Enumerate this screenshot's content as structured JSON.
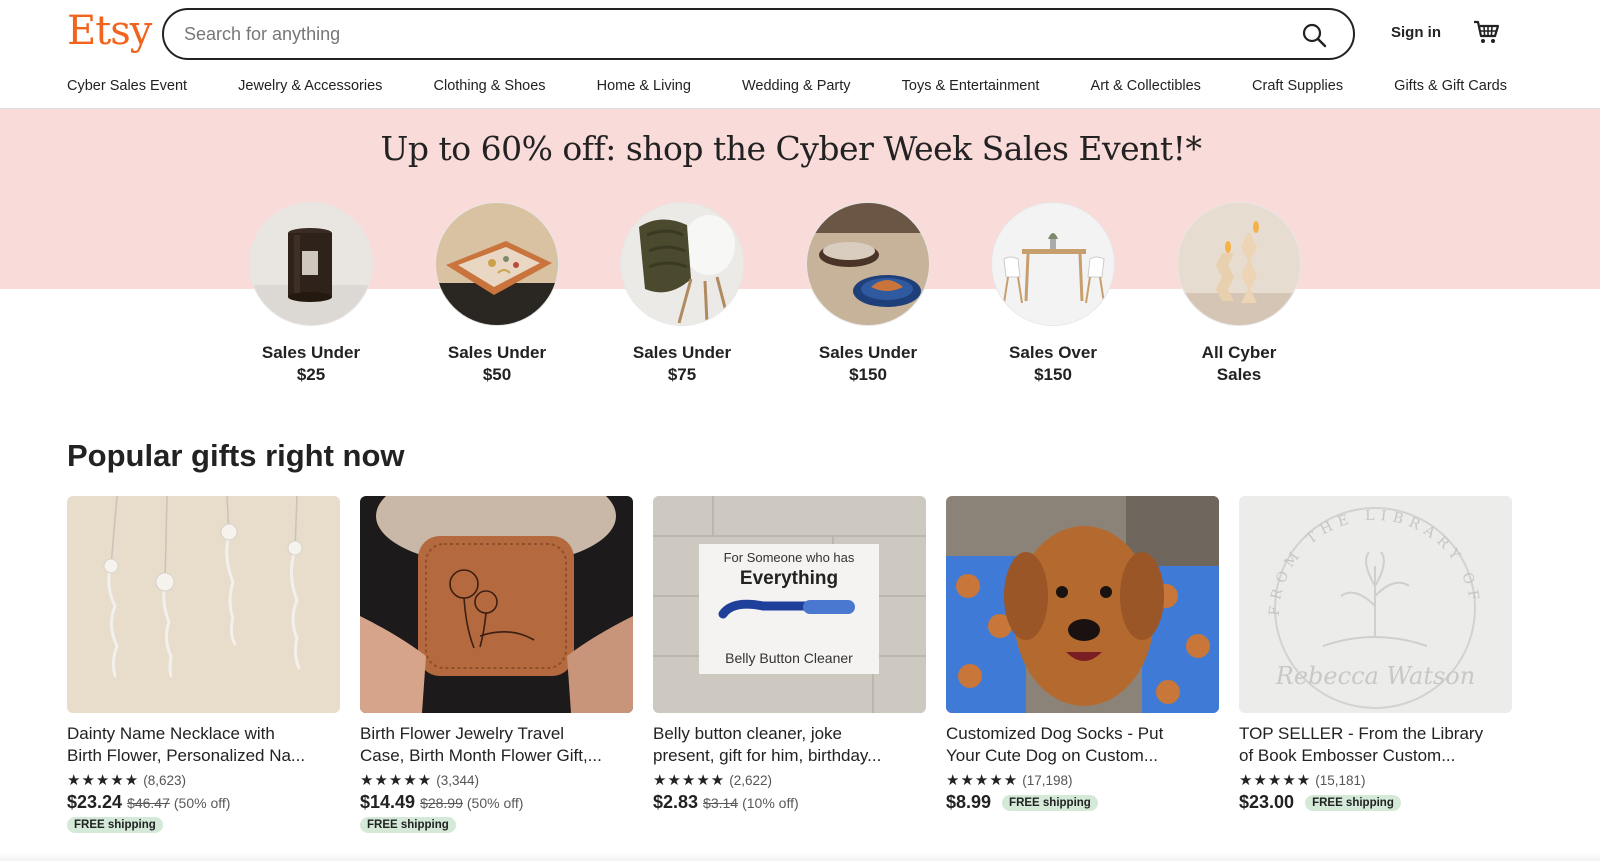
{
  "header": {
    "logo": "Etsy",
    "search_placeholder": "Search for anything",
    "sign_in": "Sign in"
  },
  "nav": [
    "Cyber Sales Event",
    "Jewelry & Accessories",
    "Clothing & Shoes",
    "Home & Living",
    "Wedding & Party",
    "Toys & Entertainment",
    "Art & Collectibles",
    "Craft Supplies",
    "Gifts & Gift Cards"
  ],
  "banner": {
    "title": "Up to 60% off: shop the Cyber Week Sales Event!*",
    "categories": [
      {
        "line1": "Sales Under",
        "line2": "$25"
      },
      {
        "line1": "Sales Under",
        "line2": "$50"
      },
      {
        "line1": "Sales Under",
        "line2": "$75"
      },
      {
        "line1": "Sales Under",
        "line2": "$150"
      },
      {
        "line1": "Sales Over",
        "line2": "$150"
      },
      {
        "line1": "All Cyber",
        "line2": "Sales"
      }
    ]
  },
  "popular": {
    "title": "Popular gifts right now",
    "items": [
      {
        "title1": "Dainty Name Necklace with",
        "title2": "Birth Flower, Personalized Na...",
        "stars": "★★★★★",
        "reviews": "(8,623)",
        "price": "$23.24",
        "original": "$46.47",
        "discount": "(50% off)",
        "shipping": "FREE shipping"
      },
      {
        "title1": "Birth Flower Jewelry Travel",
        "title2": "Case, Birth Month Flower Gift,...",
        "stars": "★★★★★",
        "reviews": "(3,344)",
        "price": "$14.49",
        "original": "$28.99",
        "discount": "(50% off)",
        "shipping": "FREE shipping"
      },
      {
        "title1": "Belly button cleaner, joke",
        "title2": "present, gift for him, birthday...",
        "stars": "★★★★★",
        "reviews": "(2,622)",
        "price": "$2.83",
        "original": "$3.14",
        "discount": "(10% off)",
        "image_text_top": "For Someone who has",
        "image_text_big": "Everything",
        "image_text_bottom": "Belly Button Cleaner"
      },
      {
        "title1": "Customized Dog Socks - Put",
        "title2": "Your Cute Dog on Custom...",
        "stars": "★★★★★",
        "reviews": "(17,198)",
        "price": "$8.99",
        "shipping": "FREE shipping"
      },
      {
        "title1": "TOP SELLER - From the Library",
        "title2": "of Book Embosser Custom...",
        "stars": "★★★★★",
        "reviews": "(15,181)",
        "price": "$23.00",
        "shipping": "FREE shipping",
        "image_text_name": "Rebecca Watson",
        "image_text_arc": "FROM THE LIBRARY OF"
      }
    ]
  },
  "colors": {
    "brand": "#f1641e",
    "banner_bg": "#f9dbda",
    "free_shipping_bg": "#d4e9d7"
  }
}
